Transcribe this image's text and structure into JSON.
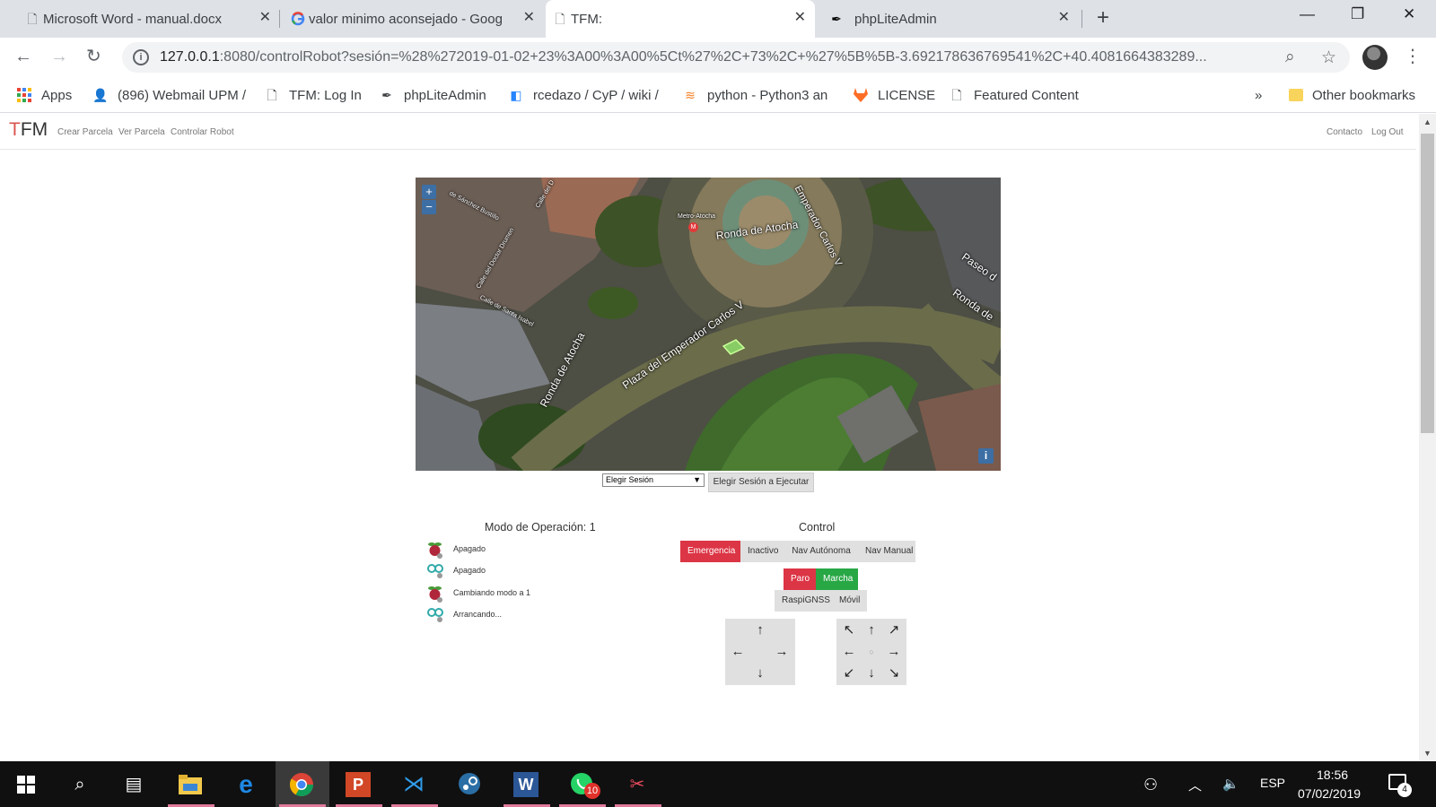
{
  "browser": {
    "tabs": [
      {
        "title": "Microsoft Word - manual.docx",
        "icon": "page-icon",
        "active": false
      },
      {
        "title": "valor minimo aconsejado - Goog",
        "icon": "google-icon",
        "active": false
      },
      {
        "title": "TFM:",
        "icon": "page-icon",
        "active": true
      },
      {
        "title": "phpLiteAdmin",
        "icon": "quill-icon",
        "active": false
      }
    ],
    "url": {
      "host": "127.0.0.1",
      "rest": ":8080/controlRobot?sesión=%28%272019-01-02+23%3A00%3A00%5Ct%27%2C+73%2C+%27%5B%5B-3.692178636769541%2C+40.4081664383289..."
    },
    "bookmarks": [
      {
        "label": "Apps",
        "icon": "apps-grid-icon"
      },
      {
        "label": "(896) Webmail UPM /",
        "icon": "webmail-icon"
      },
      {
        "label": "TFM: Log In",
        "icon": "page-icon"
      },
      {
        "label": "phpLiteAdmin",
        "icon": "quill-icon"
      },
      {
        "label": "rcedazo / CyP / wiki /",
        "icon": "bitbucket-icon"
      },
      {
        "label": "python - Python3 an",
        "icon": "stackoverflow-icon"
      },
      {
        "label": "LICENSE",
        "icon": "gitlab-icon"
      },
      {
        "label": "Featured Content",
        "icon": "page-icon"
      }
    ],
    "bookmarks_overflow": "»",
    "other_bookmarks": "Other bookmarks"
  },
  "app": {
    "brand_t": "T",
    "brand_fm": "FM",
    "nav": [
      "Crear Parcela",
      "Ver Parcela",
      "Controlar Robot"
    ],
    "nav_right": [
      "Contacto",
      "Log Out"
    ]
  },
  "map": {
    "zoom_in": "+",
    "zoom_out": "−",
    "info": "i",
    "labels": {
      "ronda_atocha_top": "Ronda de Atocha",
      "emperador_top": "Emperador Carlos V",
      "plaza": "Plaza del Emperador Carlos V",
      "ronda_atocha_left": "Ronda de Atocha",
      "paseo": "Paseo d",
      "ronda_right": "Ronda de",
      "metro": "Metro-Atocha",
      "doctor": "Calle del Doctor Drumen",
      "santa_isabel": "Calle de Santa Isabel",
      "sanchez": "de Sánchez Bustillo",
      "calle_del": "Calle del D"
    }
  },
  "session": {
    "select_value": "Elegir Sesión",
    "execute_button": "Elegir Sesión a Ejecutar"
  },
  "operation": {
    "title": "Modo de Operación: 1",
    "rows": [
      {
        "icon": "raspberry-pi-icon",
        "text": "Apagado"
      },
      {
        "icon": "robot-link-icon",
        "text": "Apagado"
      },
      {
        "icon": "raspberry-pi-icon",
        "text": "Cambiando modo a 1"
      },
      {
        "icon": "robot-link-icon",
        "text": "Arrancando..."
      }
    ]
  },
  "control": {
    "title": "Control",
    "modes": [
      "Emergencia",
      "Inactivo",
      "Nav Autónoma",
      "Nav Manual"
    ],
    "stop": "Paro",
    "start": "Marcha",
    "sources": [
      "RaspiGNSS",
      "Móvil"
    ],
    "pad_a": {
      "up": "↑",
      "left": "←",
      "right": "→",
      "down": "↓"
    },
    "pad_b": {
      "ul": "↖",
      "up": "↑",
      "ur": "↗",
      "left": "←",
      "center": "○",
      "right": "→",
      "dl": "↙",
      "down": "↓",
      "dr": "↘"
    }
  },
  "taskbar": {
    "language": "ESP",
    "time": "18:56",
    "date": "07/02/2019",
    "whatsapp_badge": "10",
    "notifications": "4"
  },
  "colors": {
    "danger": "#dc3545",
    "success": "#28a745",
    "map_button": "#3d6fa5"
  }
}
